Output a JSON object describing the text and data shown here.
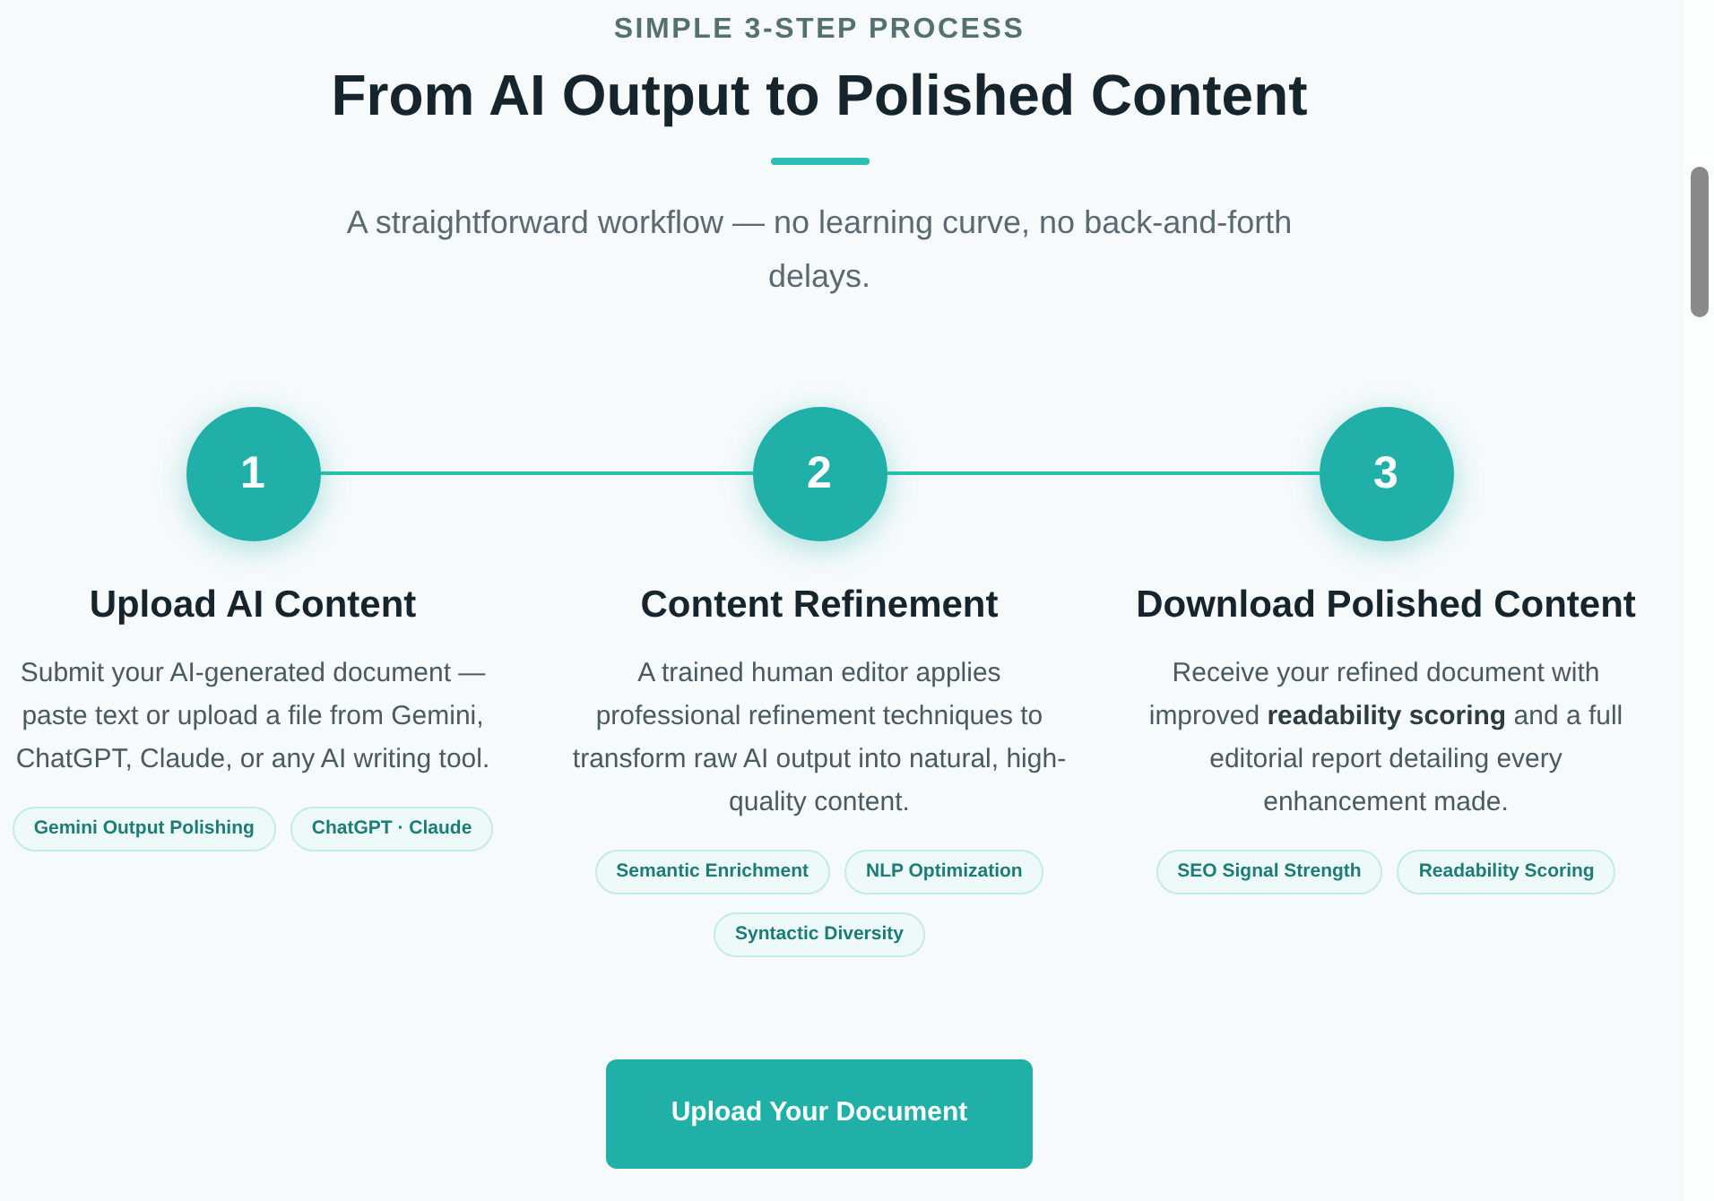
{
  "header": {
    "eyebrow": "SIMPLE 3-STEP PROCESS",
    "title": "From AI Output to Polished Content",
    "subtitle": "A straightforward workflow — no learning curve, no back-and-forth delays."
  },
  "steps": [
    {
      "number": "1",
      "title": "Upload AI Content",
      "description": "Submit your AI-generated document — paste text or upload a file from Gemini, ChatGPT, Claude, or any AI writing tool.",
      "tags": [
        "Gemini Output Polishing",
        "ChatGPT · Claude"
      ]
    },
    {
      "number": "2",
      "title": "Content Refinement",
      "description": "A trained human editor applies professional refinement techniques to transform raw AI output into natural, high-quality content.",
      "tags": [
        "Semantic Enrichment",
        "NLP Optimization",
        "Syntactic Diversity"
      ]
    },
    {
      "number": "3",
      "title": "Download Polished Content",
      "description": "Receive your refined document with improved **readability scoring** and a full editorial report detailing every enhancement made.",
      "tags": [
        "SEO Signal Strength",
        "Readability Scoring"
      ]
    }
  ],
  "cta_button": "Upload Your Document"
}
